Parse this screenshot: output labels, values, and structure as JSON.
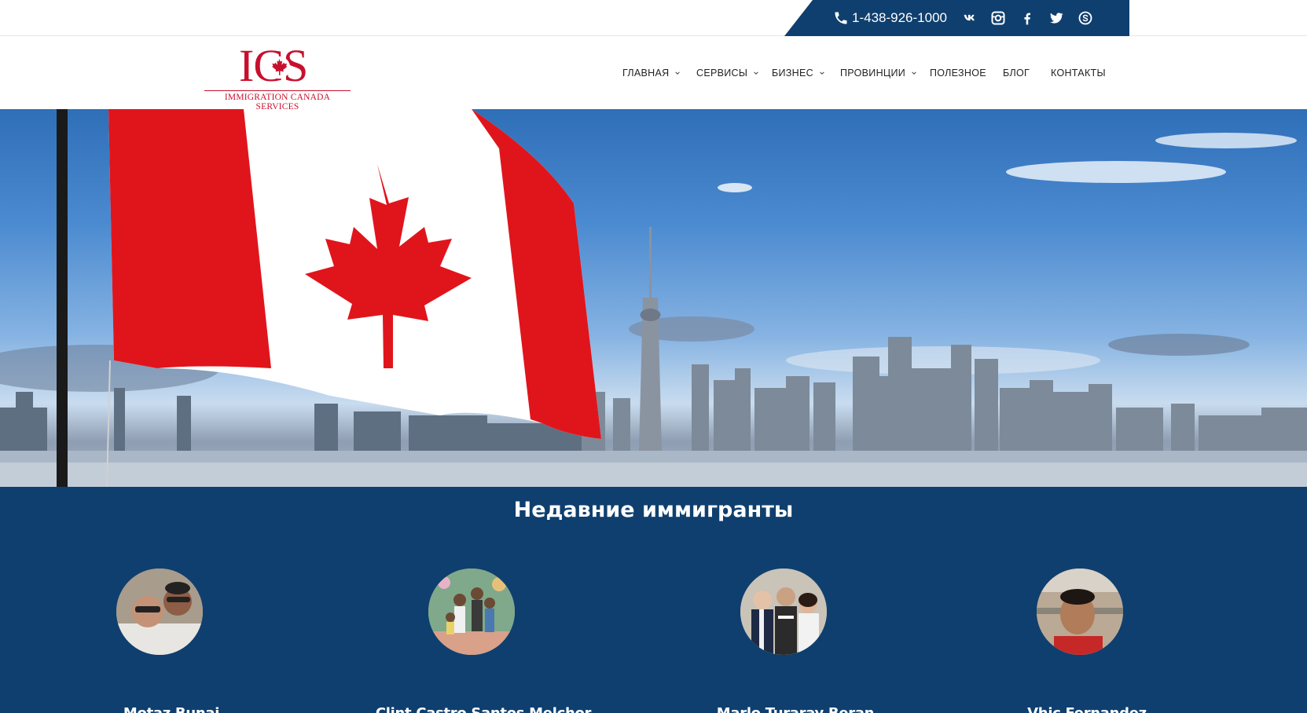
{
  "topbar": {
    "phone": "1-438-926-1000",
    "social_icons": [
      "vk-icon",
      "instagram-icon",
      "facebook-icon",
      "twitter-icon",
      "skype-icon"
    ]
  },
  "header": {
    "logo_letters": "ICS",
    "logo_subtitle": "IMMIGRATION CANADA SERVICES",
    "nav": [
      {
        "label": "ГЛАВНАЯ",
        "has_dropdown": true
      },
      {
        "label": "СЕРВИСЫ",
        "has_dropdown": true
      },
      {
        "label": "БИЗНЕС",
        "has_dropdown": true
      },
      {
        "label": "ПРОВИНЦИИ",
        "has_dropdown": true
      },
      {
        "label": "ПОЛЕЗНОЕ",
        "has_dropdown": false
      },
      {
        "label": "БЛОГ",
        "has_dropdown": false
      },
      {
        "label": "КОНТАКТЫ",
        "has_dropdown": false
      }
    ]
  },
  "immigrants": {
    "title": "Недавние иммигранты",
    "people": [
      {
        "name": "Motaz Bunai"
      },
      {
        "name": "Clint Castro Santos Melchor"
      },
      {
        "name": "Marlo Turaray Beran"
      },
      {
        "name": "Vhic Fernandez"
      }
    ]
  },
  "colors": {
    "brand_blue": "#0f3f6e",
    "logo_red": "#c8102e"
  }
}
